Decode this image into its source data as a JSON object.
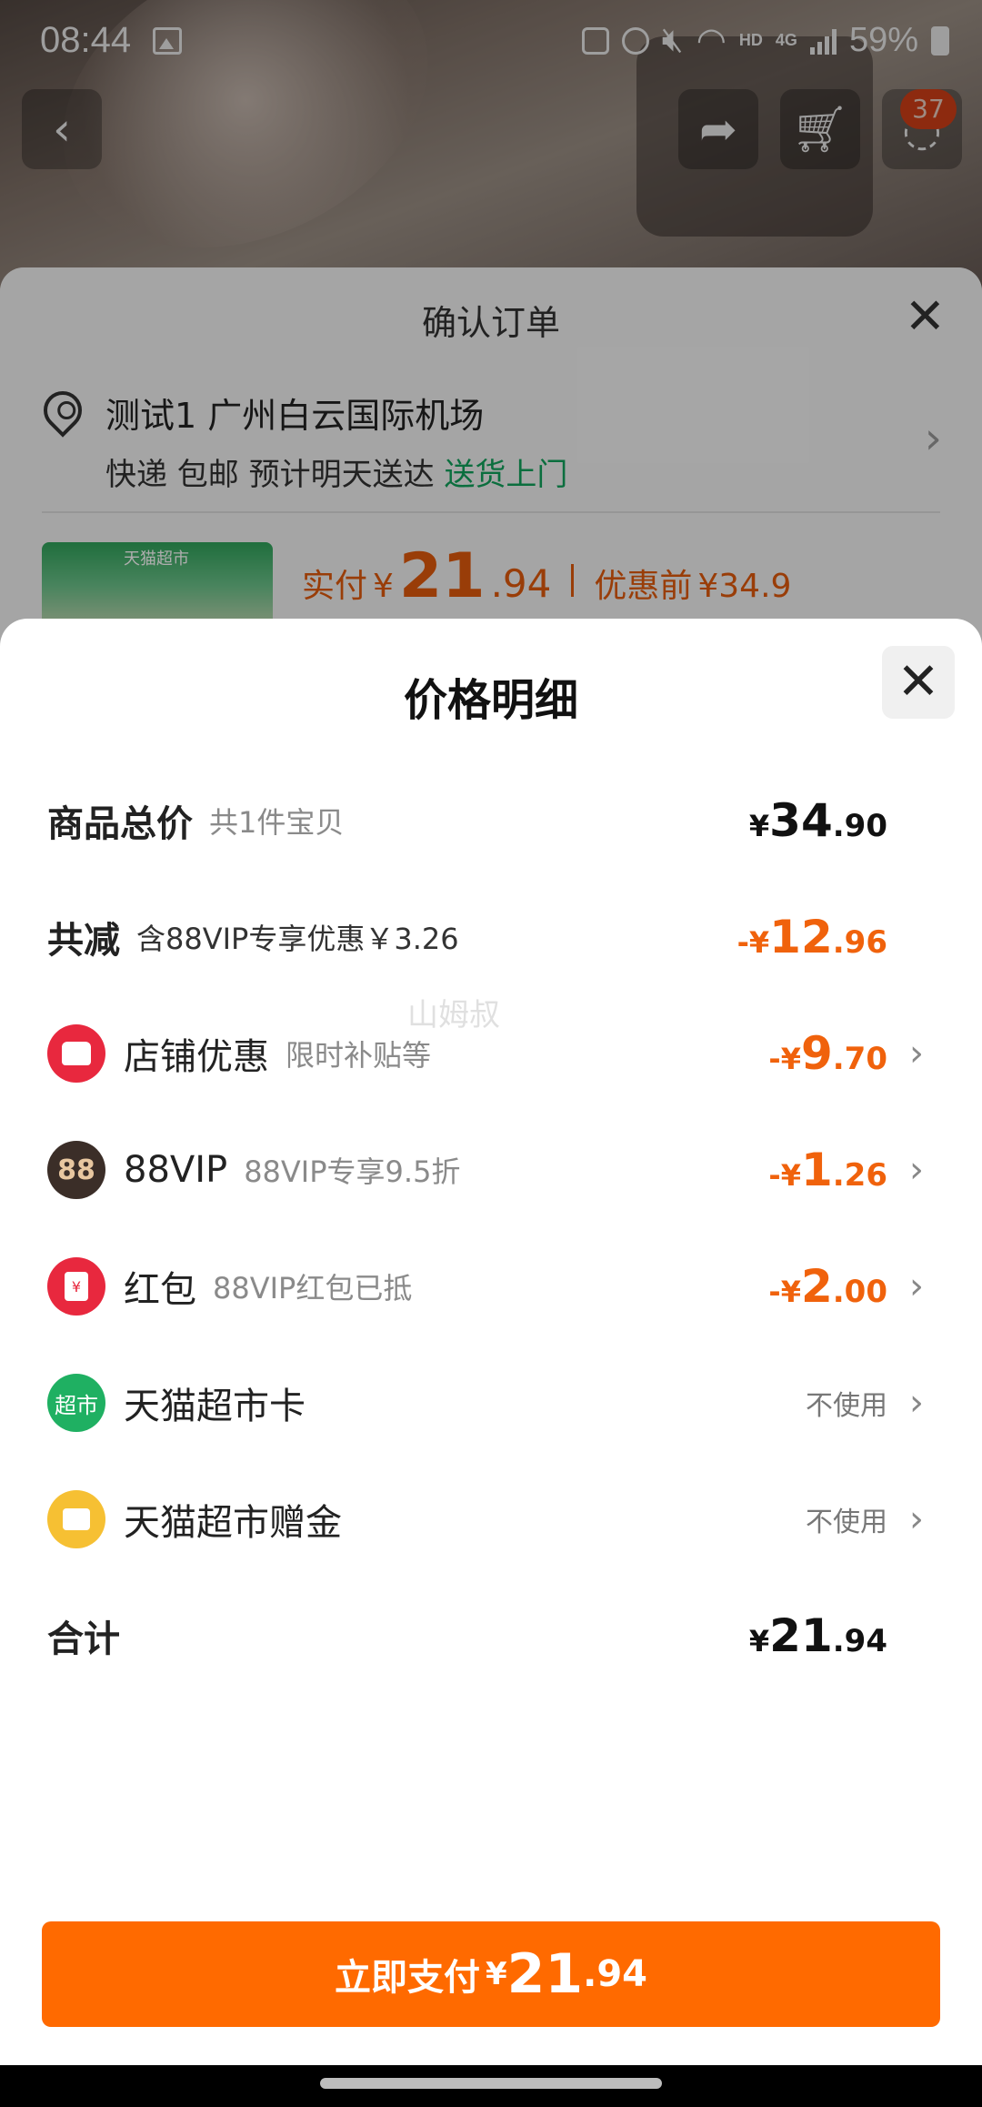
{
  "status_bar": {
    "time": "08:44",
    "network": "HD",
    "network_type": "4G",
    "battery": "59%"
  },
  "top_nav": {
    "cart_badge": "37"
  },
  "order_sheet": {
    "title": "确认订单",
    "address": "测试1 广州白云国际机场",
    "shipping": "快递 包邮 预计明天送达",
    "shipping_highlight": "送货上门",
    "product_thumb_label": "天猫超市",
    "paid_label": "实付",
    "paid_symbol": "¥",
    "paid_int": "21",
    "paid_dec": ".94",
    "before_label": "优惠前",
    "before_value": "¥34.9"
  },
  "price_detail": {
    "title": "价格明细",
    "watermark": "山姆叔",
    "rows": [
      {
        "name": "商品总价",
        "sub": "共1件宝贝",
        "symbol": "¥",
        "int": "34",
        "dec": ".90"
      },
      {
        "name": "共减",
        "sub": "含88VIP专享优惠￥3.26",
        "symbol": "-¥",
        "int": "12",
        "dec": ".96"
      },
      {
        "name": "店铺优惠",
        "sub": "限时补贴等",
        "symbol": "-¥",
        "int": "9",
        "dec": ".70",
        "icon": "store-icon"
      },
      {
        "name": "88VIP",
        "sub": "88VIP专享9.5折",
        "symbol": "-¥",
        "int": "1",
        "dec": ".26",
        "icon_text": "88"
      },
      {
        "name": "红包",
        "sub": "88VIP红包已抵",
        "symbol": "-¥",
        "int": "2",
        "dec": ".00",
        "icon": "red-packet-icon"
      },
      {
        "name": "天猫超市卡",
        "status": "不使用",
        "icon_text": "超市"
      },
      {
        "name": "天猫超市赠金",
        "status": "不使用",
        "icon": "gift-money-icon"
      }
    ],
    "total": {
      "label": "合计",
      "symbol": "¥",
      "int": "21",
      "dec": ".94"
    }
  },
  "pay_button": {
    "label": "立即支付",
    "symbol": "¥",
    "int": "21",
    "dec": ".94"
  },
  "colors": {
    "accent": "#ff6a00",
    "discount": "#f0620c",
    "green": "#11a35c"
  }
}
